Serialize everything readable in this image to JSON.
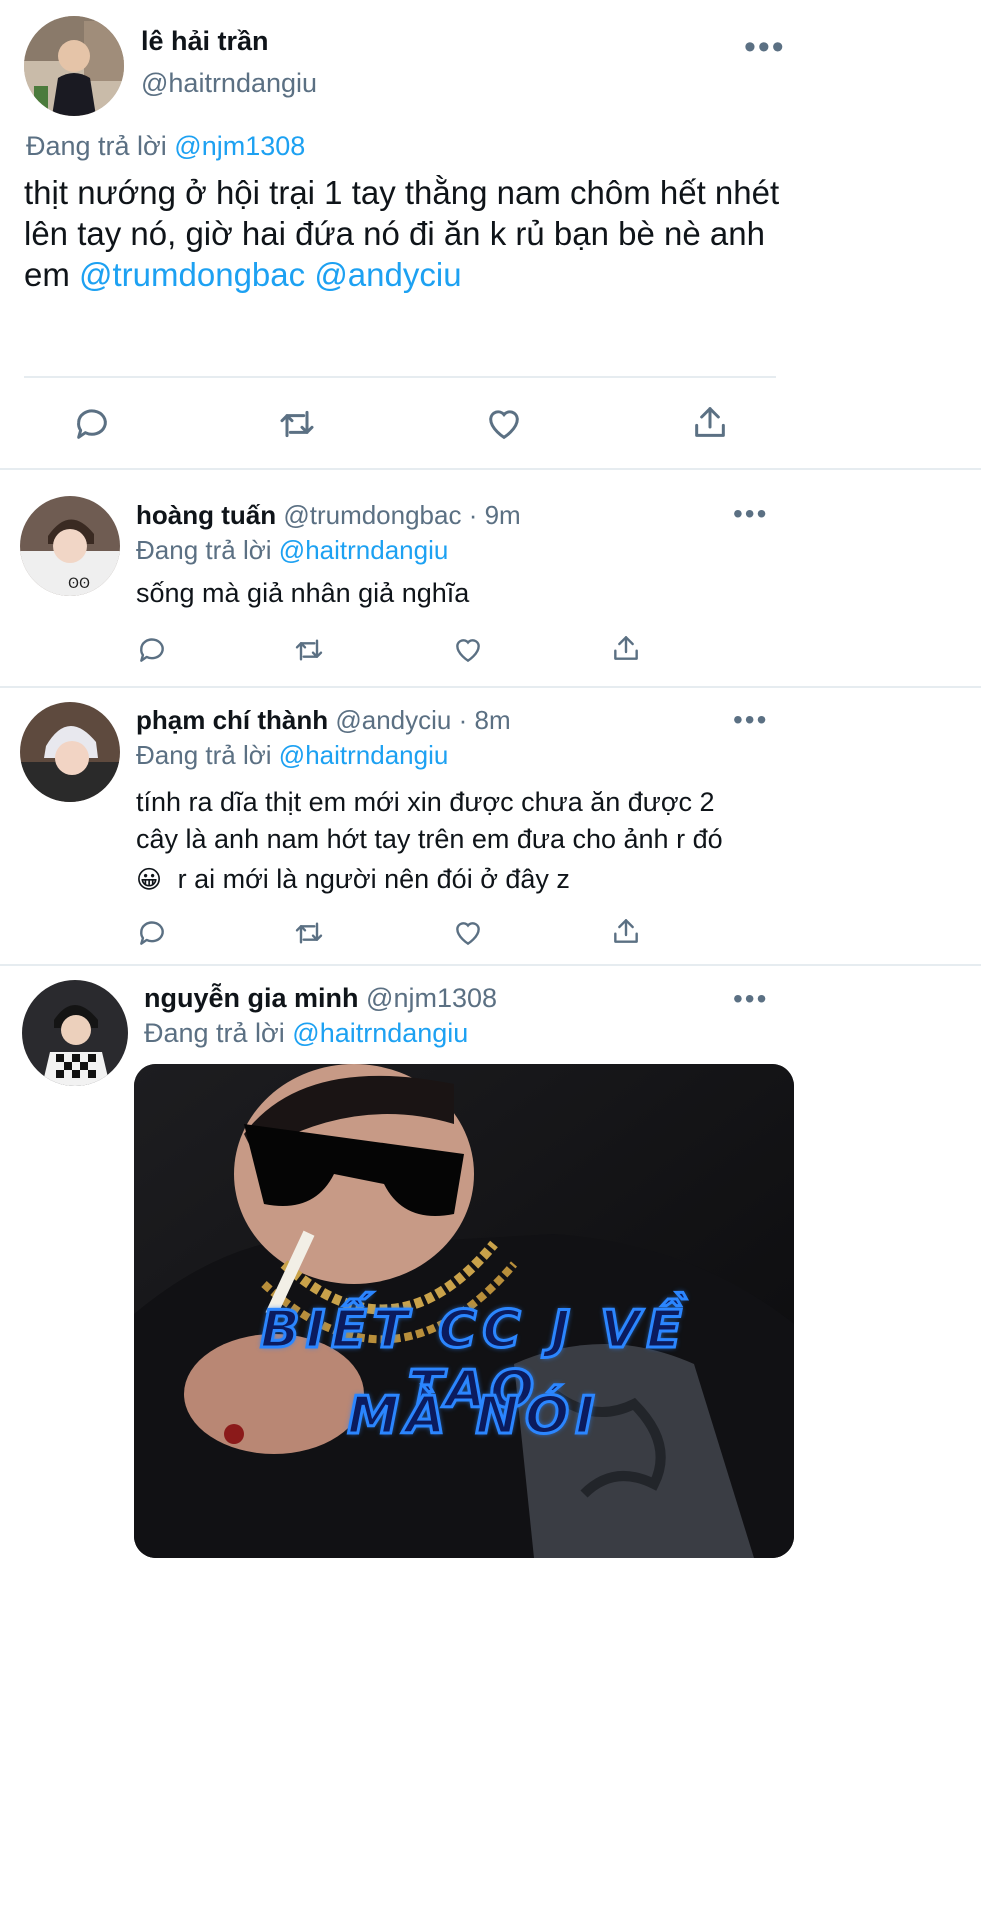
{
  "main_tweet": {
    "display_name": "lê hải trần",
    "handle": "@haitrndangiu",
    "replying_label": "Đang trả lời",
    "replying_to": "@njm1308",
    "text": "thịt nướng ở hội trại 1 tay thằng nam chôm hết nhét lên tay nó, giờ hai đứa nó đi ăn k rủ bạn bè nè anh em",
    "mention_1": "@trumdongbac",
    "mention_2": "@andyciu",
    "more_icon": "more-horizontal-icon",
    "actions": [
      "reply-icon",
      "retweet-icon",
      "like-icon",
      "share-icon"
    ]
  },
  "replies": [
    {
      "display_name": "hoàng tuấn",
      "handle": "@trumdongbac",
      "time": "· 9m",
      "replying_label": "Đang trả lời",
      "replying_to": "@haitrndangiu",
      "text": "sống mà giả nhân giả nghĩa"
    },
    {
      "display_name": "phạm chí thành",
      "handle": "@andyciu",
      "time": "· 8m",
      "replying_label": "Đang trả lời",
      "replying_to": "@haitrndangiu",
      "line_1": "tính ra dĩa thịt em mới xin được chưa ăn được 2",
      "line_2": "cây là anh nam hớt tay trên em đưa cho ảnh r đó",
      "emoji": "😀",
      "line_3": "r ai mới là người nên đói ở đây z"
    },
    {
      "display_name": "nguyễn gia minh",
      "handle": "@njm1308",
      "replying_label": "Đang trả lời",
      "replying_to": "@haitrndangiu",
      "image_caption_1": "BIẾT CC J VỀ TAO",
      "image_caption_2": "MÀ NÓI"
    }
  ],
  "colors": {
    "accent": "#1da1f2",
    "muted": "#5b7083",
    "divider": "#e6ecf0"
  }
}
